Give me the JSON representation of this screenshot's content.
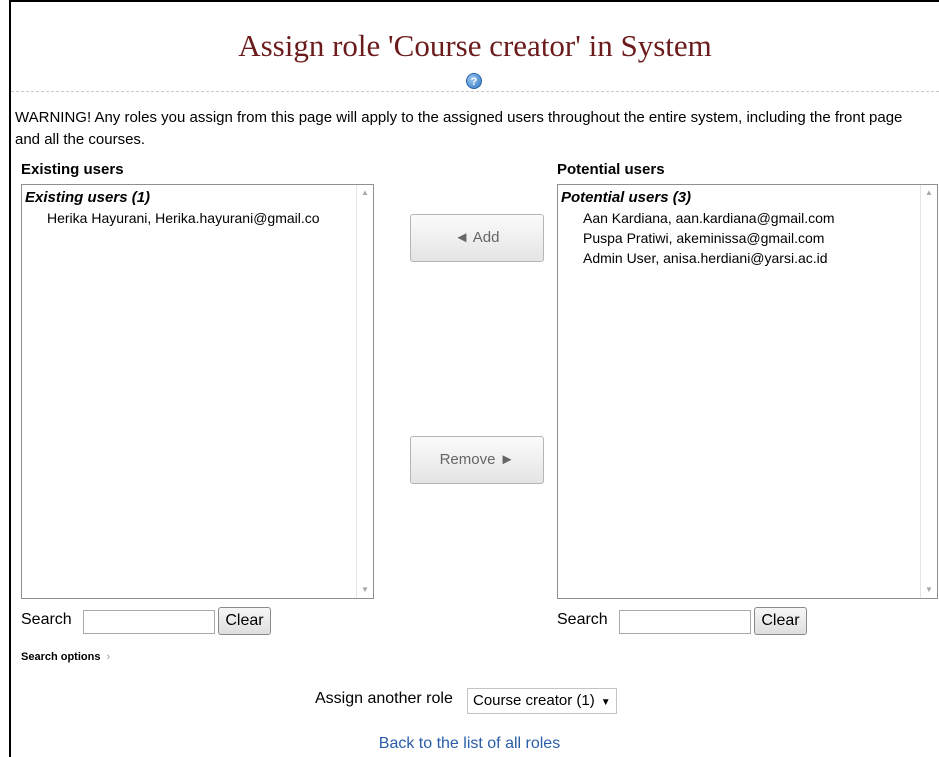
{
  "page": {
    "title": "Assign role 'Course creator' in System",
    "help_icon_glyph": "?",
    "warning": "WARNING! Any roles you assign from this page will apply to the assigned users throughout the entire system, including the front page and all the courses."
  },
  "existing": {
    "label": "Existing users",
    "group_heading": "Existing users (1)",
    "users": [
      "Herika Hayurani, Herika.hayurani@gmail.co"
    ]
  },
  "potential": {
    "label": "Potential users",
    "group_heading": "Potential users (3)",
    "users": [
      "Aan Kardiana, aan.kardiana@gmail.com",
      "Puspa Pratiwi, akeminissa@gmail.com",
      "Admin User, anisa.herdiani@yarsi.ac.id"
    ]
  },
  "buttons": {
    "add": "◄ Add",
    "remove": "Remove ►"
  },
  "search": {
    "label": "Search",
    "clear": "Clear",
    "value": ""
  },
  "search_options": {
    "label": "Search options",
    "chevron": "›"
  },
  "assign_another": {
    "label": "Assign another role",
    "selected": "Course creator (1)",
    "caret": "▼"
  },
  "back_link": "Back to the list of all roles",
  "colors": {
    "title": "#6b1b1b",
    "link": "#2a5ea8",
    "help_icon": "#2f78c4"
  },
  "icons": {
    "help": "help-icon",
    "scroll_up": "chevron-up-icon",
    "scroll_down": "chevron-down-icon"
  }
}
